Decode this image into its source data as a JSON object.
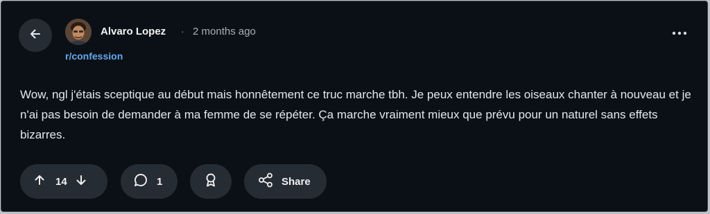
{
  "post": {
    "author": "Alvaro Lopez",
    "separator": "·",
    "time": "2 months ago",
    "subreddit": "r/confession",
    "body": "Wow, ngl j'étais sceptique au début mais honnêtement ce truc marche tbh. Je peux entendre les oiseaux chanter à nouveau et je n'ai pas besoin de demander à ma femme de se répéter. Ça marche vraiment mieux que prévu pour un naturel sans effets bizarres."
  },
  "actions": {
    "votes": "14",
    "comments": "1",
    "share_label": "Share"
  },
  "icons": {
    "back": "arrow-left-icon",
    "more": "more-horizontal-icon",
    "upvote": "arrow-up-icon",
    "downvote": "arrow-down-icon",
    "comment": "comment-bubble-icon",
    "award": "award-icon",
    "share": "share-icon"
  },
  "colors": {
    "background": "#0b1016",
    "pill": "#262c34",
    "subreddit_link": "#64a8f0"
  }
}
